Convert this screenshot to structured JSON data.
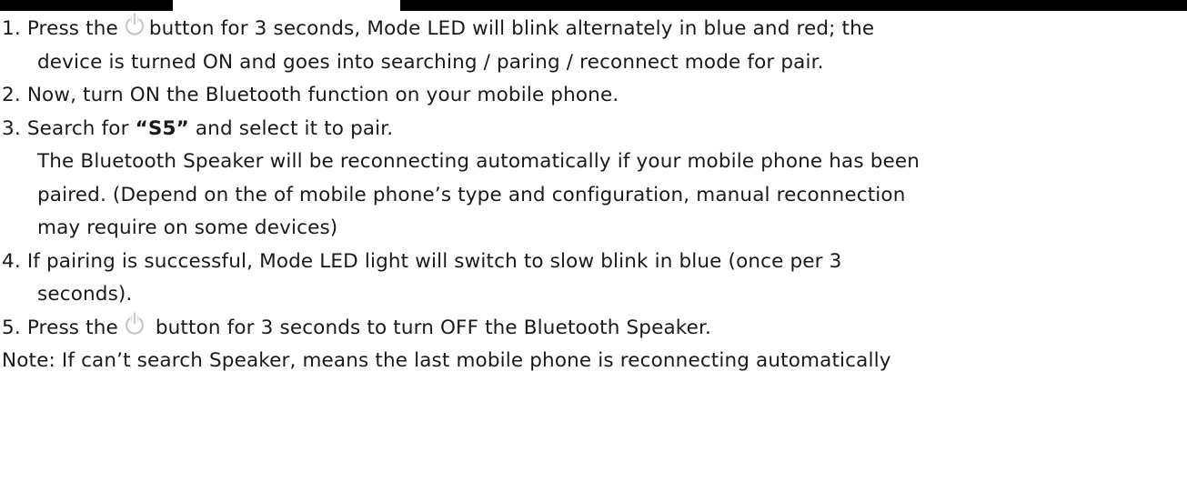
{
  "step1": {
    "number": "1.",
    "prefix": "Press the",
    "icon": "power-button-icon",
    "suffix": "button for 3 seconds, Mode LED will blink alternately in blue and red; the",
    "continuation": "device is turned ON and goes into searching / paring / reconnect mode for pair."
  },
  "step2": {
    "number": "2.",
    "text": "Now, turn ON the Bluetooth function on your mobile phone."
  },
  "step3": {
    "number": "3.",
    "prefix": "Search for",
    "highlight": "“S5”",
    "suffix": "and select it to pair.",
    "detail_line1": "The Bluetooth Speaker will be reconnecting automatically if your mobile phone has been",
    "detail_line2": "paired. (Depend on the of mobile phone’s type and configuration, manual reconnection",
    "detail_line3": "may require on some devices)"
  },
  "step4": {
    "number": "4.",
    "text": "If pairing is successful, Mode LED light will switch to slow blink in blue (once per 3",
    "continuation": "seconds)."
  },
  "step5": {
    "number": "5.",
    "prefix": "Press the",
    "icon": "power-button-icon",
    "suffix": "button for 3 seconds to turn OFF the Bluetooth Speaker."
  },
  "note": {
    "text": "Note: If can’t search Speaker, means the last mobile phone is reconnecting automatically"
  },
  "colors": {
    "header_bar": "#000000",
    "text": "#1a1a1a",
    "icon": "#c8c8c8"
  }
}
